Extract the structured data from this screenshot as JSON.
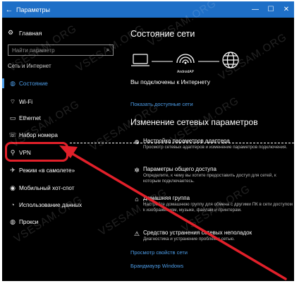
{
  "titlebar": {
    "back_glyph": "←",
    "title": "Параметры",
    "minimize": "—",
    "maximize": "☐",
    "close": "✕"
  },
  "sidebar": {
    "home_label": "Главная",
    "search_placeholder": "Найти параметр",
    "section_label": "Сеть и Интернет",
    "items": [
      {
        "label": "Состояние",
        "icon": "globe-icon"
      },
      {
        "label": "Wi-Fi",
        "icon": "wifi-icon"
      },
      {
        "label": "Ethernet",
        "icon": "ethernet-icon"
      },
      {
        "label": "Набор номера",
        "icon": "dialup-icon"
      },
      {
        "label": "VPN",
        "icon": "vpn-icon"
      },
      {
        "label": "Режим «в самолете»",
        "icon": "airplane-icon"
      },
      {
        "label": "Мобильный хот-спот",
        "icon": "hotspot-icon"
      },
      {
        "label": "Использование данных",
        "icon": "data-usage-icon"
      },
      {
        "label": "Прокси",
        "icon": "globe-icon"
      }
    ],
    "active_index": 0
  },
  "main": {
    "status_title": "Состояние сети",
    "network_name": "AndroidAP",
    "status_message": "Вы подключены к Интернету",
    "available_networks_link": "Показать доступные сети",
    "change_title": "Изменение сетевых параметров",
    "options": [
      {
        "title": "Настройка параметров адаптера",
        "desc": "Просмотр сетевых адаптеров и изменение параметров подключения.",
        "icon": "adapter-icon"
      },
      {
        "title": "Параметры общего доступа",
        "desc": "Определите, к чему вы хотите предоставить доступ для сетей, к которым подключаетесь.",
        "icon": "sharing-icon"
      },
      {
        "title": "Домашняя группа",
        "desc": "Настройте домашнюю группу для обмена с другими ПК в сети доступом к изображениям, музыке, файлам и принтерам.",
        "icon": "homegroup-icon"
      },
      {
        "title": "Средство устранения сетевых неполадок",
        "desc": "Диагностика и устранение проблем с сетью.",
        "icon": "warning-icon"
      }
    ],
    "properties_link": "Просмотр свойств сети",
    "firewall_link": "Брандмауэр Windows"
  },
  "watermark": "VSESAM.ORG",
  "colors": {
    "titlebar": "#1e6fc7",
    "accent": "#4d9de8",
    "annotation": "#e2202a"
  }
}
